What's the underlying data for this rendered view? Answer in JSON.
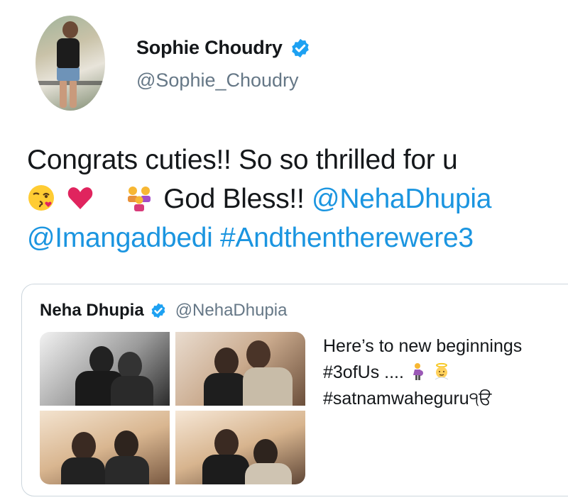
{
  "author": {
    "name": "Sophie Choudry",
    "handle": "@Sophie_Choudry",
    "verified": true
  },
  "tweet": {
    "line1": "Congrats cuties!! So so thrilled for u",
    "line2_text": "God Bless!!",
    "line2_mention": "@NehaDhupia",
    "line3_mention": "@Imangadbedi",
    "line3_hashtag": "#Andthentherewere3",
    "emojis": [
      "kissing-face-icon",
      "red-heart-icon",
      "family-icon"
    ]
  },
  "quoted_tweet": {
    "name": "Neha Dhupia",
    "handle": "@NehaDhupia",
    "verified": true,
    "line1": "Here’s to new beginnings",
    "line2": "#3ofUs ....",
    "line3": "#satnamwaheguru੧ੳ",
    "emojis": [
      "pregnant-woman-icon",
      "baby-angel-icon"
    ],
    "photos": [
      "photo-1",
      "photo-2",
      "photo-3",
      "photo-4"
    ]
  },
  "colors": {
    "link": "#1b95e0",
    "verified": "#1da1f2",
    "secondary_text": "#657786",
    "border": "#ccd6dd"
  }
}
